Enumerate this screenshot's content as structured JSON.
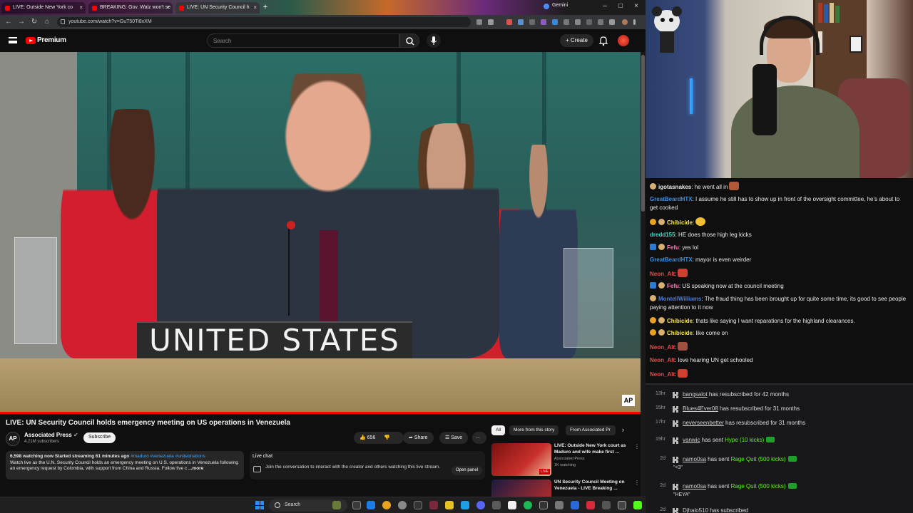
{
  "browser": {
    "tabs": [
      {
        "title": "LIVE: Outside New York co",
        "active": false
      },
      {
        "title": "BREAKING: Gov. Walz won't se",
        "active": false
      },
      {
        "title": "LIVE: UN Security Council h",
        "active": true
      }
    ],
    "extra_tab": "Gemini",
    "url": "youtube.com/watch?v=GuT50Ti8xXM"
  },
  "youtube": {
    "brand": "Premium",
    "search_placeholder": "Search",
    "create_label": "Create"
  },
  "video": {
    "nameplate": "UNITED STATES",
    "watermark": "AP",
    "title": "LIVE: UN Security Council holds emergency meeting on US operations in Venezuela",
    "channel": "Associated Press",
    "channel_initials": "AP",
    "subscribers": "4.21M subscribers",
    "subscribe_label": "Subscribe",
    "likes": "656",
    "share_label": "Share",
    "save_label": "Save",
    "more_label": "...",
    "description_stats": "6,598 watching now  Started streaming 61 minutes ago",
    "description_tags": "#maduro #venezuela #unitednations",
    "description_text": "Watch live as the U.N. Security Council holds an emergency meeting on U.S. operations in Venezuela following an emergency request by Colombia, with support from China and Russia. Follow live c",
    "description_more": "...more",
    "live_chat_label": "Live chat",
    "live_chat_message": "Join the conversation to interact with the creator and others watching this live stream.",
    "open_panel_label": "Open panel"
  },
  "related": {
    "chips": [
      "All",
      "More from this story",
      "From Associated Pr"
    ],
    "items": [
      {
        "title": "LIVE: Outside New York court as Maduro and wife make first ...",
        "channel": "Associated Press",
        "meta": "1K watching",
        "badge": "LIVE"
      },
      {
        "title": "UN Security Council Meeting on Venezuela - LIVE Breaking ...",
        "channel": "",
        "meta": "",
        "badge": ""
      }
    ]
  },
  "chat": {
    "messages": [
      {
        "user": "igotasnakes",
        "text": " he went all in",
        "color": "#f5f5f5",
        "emote": true
      },
      {
        "user": "GreatBeardHTX",
        "text": " I assume he still has to show up in front of the oversight committee, he's about to get cooked",
        "color": "#3b8fe0"
      },
      {
        "user": "Chibicide",
        "text": "",
        "color": "#f5f5f5",
        "emote": true
      },
      {
        "user": "dredd155",
        "text": " HE does those high leg kicks",
        "color": "#48d8c4"
      },
      {
        "user": "Fefu",
        "text": " yes lol",
        "color": "#ff7ab6"
      },
      {
        "user": "GreatBeardHTX",
        "text": " mayor is even weirder",
        "color": "#3b8fe0"
      },
      {
        "user": "Neon_Alt",
        "text": "",
        "color": "#e84c4c",
        "emote": true
      },
      {
        "user": "Fefu",
        "text": " US speaking now at the council meeting",
        "color": "#ff7ab6"
      },
      {
        "user": "MontellWilliams",
        "text": " The fraud thing has been brought up for quite some time, its good to see people paying attention to it now",
        "color": "#4f7dd6"
      },
      {
        "user": "Chibicide",
        "text": " thats like saying I want reparations for the highland clearances.",
        "color": "#f5f5f5"
      },
      {
        "user": "Chibicide",
        "text": " like come on",
        "color": "#f5f5f5"
      },
      {
        "user": "Neon_Alt",
        "text": "",
        "color": "#e84c4c",
        "emote": true
      },
      {
        "user": "Neon_Alt",
        "text": " love hearing UN get schooled",
        "color": "#e84c4c"
      },
      {
        "user": "Neon_Alt",
        "text": "",
        "color": "#e84c4c",
        "emote": true
      }
    ]
  },
  "events": [
    {
      "time": "13hr",
      "user": "bangsalot",
      "action": " has resubscribed for 42 months",
      "gift": "",
      "sub": ""
    },
    {
      "time": "15hr",
      "user": "Blues4Ever08",
      "action": " has resubscribed for 31 months",
      "gift": "",
      "sub": ""
    },
    {
      "time": "17hr",
      "user": "neverseenbetter",
      "action": " has resubscribed for 31 months",
      "gift": "",
      "sub": ""
    },
    {
      "time": "19hr",
      "user": "vanwic",
      "action": " has sent ",
      "gift": "Hype (10 kicks)",
      "sub": ""
    },
    {
      "time": "2d",
      "user": "namo0sa",
      "action": " has sent ",
      "gift": "Rage Quit (500 kicks)",
      "sub": "\"<3\""
    },
    {
      "time": "2d",
      "user": "namo0sa",
      "action": " has sent ",
      "gift": "Rage Quit (500 kicks)",
      "sub": "\"HEYA\""
    },
    {
      "time": "2d",
      "user": "Djhalo510",
      "action": " has subscribed",
      "gift": "",
      "sub": ""
    }
  ],
  "taskbar": {
    "search_label": "Search"
  },
  "colors": {
    "youtube_red": "#ff0000",
    "kick_green": "#53fc18",
    "bg": "#0f0f0f"
  }
}
